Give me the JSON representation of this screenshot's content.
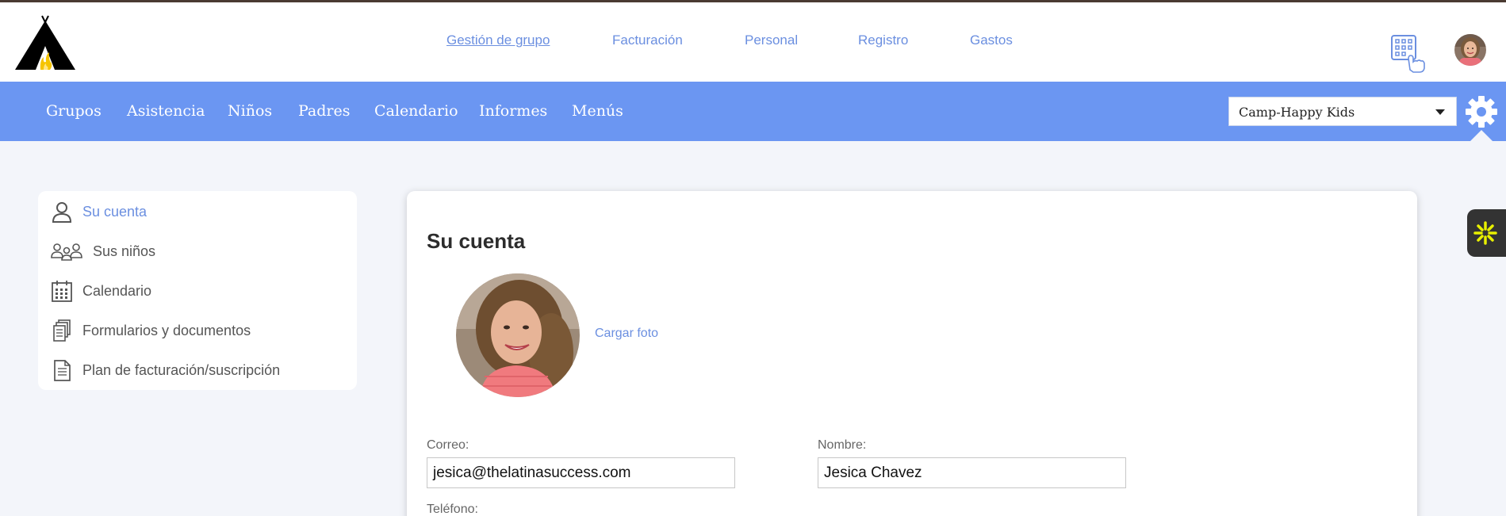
{
  "topnav": [
    {
      "label": "Gestión de grupo",
      "active": true
    },
    {
      "label": "Facturación",
      "active": false
    },
    {
      "label": "Personal",
      "active": false
    },
    {
      "label": "Registro",
      "active": false
    },
    {
      "label": "Gastos",
      "active": false
    }
  ],
  "mainnav": [
    "Grupos",
    "Asistencia",
    "Niños",
    "Padres",
    "Calendario",
    "Informes",
    "Menús"
  ],
  "school_select": {
    "value": "Camp-Happy Kids"
  },
  "sidebar": {
    "items": [
      {
        "label": "Su cuenta",
        "icon": "user-icon",
        "active": true
      },
      {
        "label": "Sus niños",
        "icon": "group-icon",
        "active": false
      },
      {
        "label": "Calendario",
        "icon": "calendar-icon",
        "active": false
      },
      {
        "label": "Formularios y documentos",
        "icon": "documents-icon",
        "active": false
      },
      {
        "label": "Plan de facturación/suscripción",
        "icon": "document-icon",
        "active": false
      }
    ]
  },
  "account": {
    "title": "Su cuenta",
    "upload_label": "Cargar foto",
    "email_label": "Correo:",
    "email_value": "jesica@thelatinasuccess.com",
    "name_label": "Nombre:",
    "name_value": "Jesica Chavez",
    "phone_label": "Teléfono:"
  },
  "colors": {
    "accent": "#6b96f2",
    "link": "#6b8fe0",
    "help_tab": "#333333",
    "help_icon": "#e8f000"
  }
}
